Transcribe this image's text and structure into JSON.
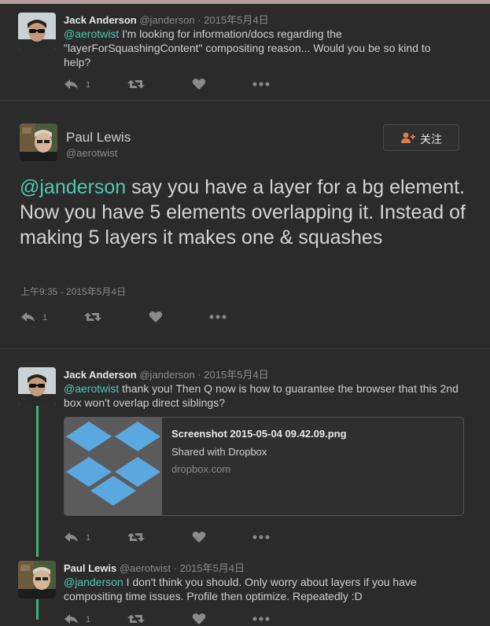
{
  "tweets": [
    {
      "name": "Jack Anderson",
      "handle": "@janderson",
      "sep": "·",
      "time": "2015年5月4日",
      "mention": "@aerotwist",
      "text": " I'm looking for information/docs regarding the \"layerForSquashingContent\" compositing reason... Would you be so kind to help?",
      "reply_count": "1"
    },
    {
      "name": "Paul Lewis",
      "handle": "@aerotwist",
      "follow_label": "关注",
      "mention": "@janderson",
      "text": " say you have a layer for a bg element. Now you have 5 elements overlapping it. Instead of making 5 layers it makes one & squashes",
      "timestamp": "上午9:35 - 2015年5月4日",
      "reply_count": "1"
    },
    {
      "name": "Jack Anderson",
      "handle": "@janderson",
      "sep": "·",
      "time": "2015年5月4日",
      "mention": "@aerotwist",
      "text": " thank you! Then Q now is how to guarantee the browser that this 2nd box won't overlap direct siblings?",
      "reply_count": "1",
      "card": {
        "title": "Screenshot 2015-05-04 09.42.09.png",
        "subtitle": "Shared with Dropbox",
        "domain": "dropbox.com"
      }
    },
    {
      "name": "Paul Lewis",
      "handle": "@aerotwist",
      "sep": "·",
      "time": "2015年5月4日",
      "mention": "@janderson",
      "text": " I don't think you should. Only worry about layers if you have compositing time issues. Profile then optimize. Repeatedly :D",
      "reply_count": "1"
    }
  ],
  "icons": {
    "reply": "reply-icon",
    "retweet": "retweet-icon",
    "favorite": "heart-icon",
    "more": "more-icon",
    "follow": "follow-user-icon",
    "card_logo": "dropbox-logo-icon"
  },
  "colors": {
    "background": "#2b2b2b",
    "mention": "#4ec9b0",
    "thread_line": "#3fb27f",
    "follow_icon": "#e07b4a",
    "dropbox_blue": "#5ba8e0"
  }
}
